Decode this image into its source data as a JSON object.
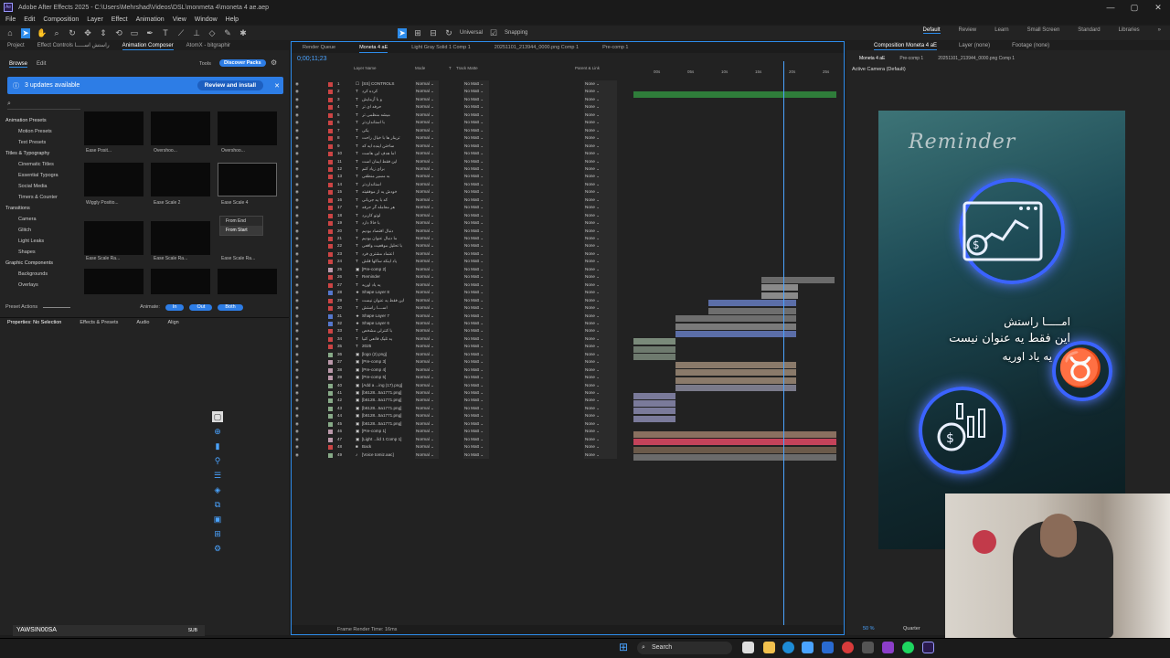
{
  "app": {
    "title": "Adobe After Effects 2025 - C:\\Users\\Mehrshad\\Videos\\DSL\\monmeta 4\\moneta 4 ae.aep",
    "window_controls": [
      "—",
      "▢",
      "✕"
    ]
  },
  "menu": [
    "File",
    "Edit",
    "Composition",
    "Layer",
    "Effect",
    "Animation",
    "View",
    "Window",
    "Help"
  ],
  "toolbar": {
    "universal_label": "Universal",
    "snapping_label": "Snapping"
  },
  "workspaces": [
    "Default",
    "Review",
    "Learn",
    "Small Screen",
    "Standard",
    "Libraries"
  ],
  "left_panel": {
    "tabs": [
      "Project",
      "Effect Controls راستش اســـــا",
      "Animation Composer",
      "AtomX - bitgraphir"
    ],
    "subtabs": [
      "Browse",
      "Edit"
    ],
    "tools_label": "Tools",
    "discover_label": "Discover Packs",
    "banner_text": "3 updates available",
    "banner_button": "Review and install",
    "tree": [
      {
        "label": "Animation Presets",
        "level": 0
      },
      {
        "label": "Motion Presets",
        "level": 1
      },
      {
        "label": "Text Presets",
        "level": 1
      },
      {
        "label": "Titles & Typography",
        "level": 0
      },
      {
        "label": "Cinematic Titles",
        "level": 1
      },
      {
        "label": "Essential Typogra",
        "level": 1
      },
      {
        "label": "Social Media",
        "level": 1
      },
      {
        "label": "Timers & Counter",
        "level": 1
      },
      {
        "label": "Transitions",
        "level": 0
      },
      {
        "label": "Camera",
        "level": 1
      },
      {
        "label": "Glitch",
        "level": 1
      },
      {
        "label": "Light Leaks",
        "level": 1
      },
      {
        "label": "Shapes",
        "level": 1
      },
      {
        "label": "Graphic Components",
        "level": 0
      },
      {
        "label": "Backgrounds",
        "level": 1
      },
      {
        "label": "Overlays",
        "level": 1
      }
    ],
    "thumbs": [
      "Ease Posit...",
      "Overshoo...",
      "Overshoo...",
      "Wiggly Positio...",
      "Ease Scale 2",
      "Ease Scale 4",
      "Ease Scale Ra...",
      "Ease Scale Ra...",
      "Ease Scale Ra..."
    ],
    "dropdown": [
      "From End",
      "From Start"
    ],
    "preset_actions": "Preset Actions",
    "animate_label": "Animate:",
    "animate_buttons": [
      "In",
      "Out",
      "Both"
    ],
    "bottom_tabs": [
      "Properties: No Selection",
      "Effects & Presets",
      "Audio",
      "Align"
    ],
    "user_label": "YAWSIN00SA",
    "user_tag": "SUB"
  },
  "timeline": {
    "tabs": [
      "Render Queue",
      "Moneta 4 aE",
      "Light Gray Solid 1 Comp 1",
      "20251101_213944_0000.png Comp 1",
      "Pre-comp 1"
    ],
    "timecode": "0;00;11;23",
    "columns": [
      "Layer Name",
      "Mode",
      "T",
      "Track Matte",
      "Parent & Link"
    ],
    "footer": "Frame Render Time: 16ms",
    "layers": [
      {
        "n": "1",
        "ic": "☐",
        "name": "[SS] CONTROLS",
        "c": "#c44"
      },
      {
        "n": "2",
        "ic": "T",
        "name": "کرده کرد",
        "c": "#c44"
      },
      {
        "n": "3",
        "ic": "T",
        "name": "و با آزمایش",
        "c": "#c44"
      },
      {
        "n": "4",
        "ic": "T",
        "name": "حرفه ای تر",
        "c": "#c44"
      },
      {
        "n": "5",
        "ic": "T",
        "name": "میشه منظمی تر",
        "c": "#c44"
      },
      {
        "n": "6",
        "ic": "T",
        "name": "با استانداردتر",
        "c": "#c44"
      },
      {
        "n": "7",
        "ic": "T",
        "name": "یکی",
        "c": "#c44"
      },
      {
        "n": "8",
        "ic": "T",
        "name": "ترینار ها با خیال راحت",
        "c": "#c44"
      },
      {
        "n": "9",
        "ic": "T",
        "name": "ساختن اینده ایه که",
        "c": "#c44"
      },
      {
        "n": "10",
        "ic": "T",
        "name": "اما هدف این هاست",
        "c": "#c44"
      },
      {
        "n": "11",
        "ic": "T",
        "name": "این فقط ایمان است",
        "c": "#c44"
      },
      {
        "n": "12",
        "ic": "T",
        "name": "برای زیاد کنم",
        "c": "#c44"
      },
      {
        "n": "13",
        "ic": "T",
        "name": "به مسیر منطقی",
        "c": "#c44"
      },
      {
        "n": "14",
        "ic": "T",
        "name": "استانداردتر",
        "c": "#c44"
      },
      {
        "n": "15",
        "ic": "T",
        "name": "خودش یه از موفقیته",
        "c": "#c44"
      },
      {
        "n": "16",
        "ic": "T",
        "name": "که با یه جریانی",
        "c": "#c44"
      },
      {
        "n": "17",
        "ic": "T",
        "name": "هر معامله گر حرفه",
        "c": "#c44"
      },
      {
        "n": "18",
        "ic": "T",
        "name": "لوتو کاربرد",
        "c": "#c44"
      },
      {
        "n": "19",
        "ic": "T",
        "name": "با خالا دارد",
        "c": "#c44"
      },
      {
        "n": "20",
        "ic": "T",
        "name": "دنبال اقتصاد بودیم",
        "c": "#c44"
      },
      {
        "n": "21",
        "ic": "T",
        "name": "ما دنبال عنوان بودیم",
        "c": "#c44"
      },
      {
        "n": "22",
        "ic": "T",
        "name": "با تحلیل موقعیت واقعی",
        "c": "#c44"
      },
      {
        "n": "23",
        "ic": "T",
        "name": "اعتماد مشتری فرد",
        "c": "#c44"
      },
      {
        "n": "24",
        "ic": "T",
        "name": "یاد اینکه ساکها قلش",
        "c": "#c44"
      },
      {
        "n": "25",
        "ic": "▣",
        "name": "[Pre-comp 2]",
        "c": "#b9a"
      },
      {
        "n": "26",
        "ic": "T",
        "name": "Reminder",
        "c": "#c44"
      },
      {
        "n": "27",
        "ic": "T",
        "name": "یه یاد اوریه",
        "c": "#c44"
      },
      {
        "n": "28",
        "ic": "★",
        "name": "Shape Layer 8",
        "c": "#57c"
      },
      {
        "n": "29",
        "ic": "T",
        "name": "این فقط یه عنوان نیست",
        "c": "#c44"
      },
      {
        "n": "30",
        "ic": "T",
        "name": "اســــا راستش",
        "c": "#c44"
      },
      {
        "n": "31",
        "ic": "★",
        "name": "Shape Layer 7",
        "c": "#57c"
      },
      {
        "n": "32",
        "ic": "★",
        "name": "Shape Layer 6",
        "c": "#57c"
      },
      {
        "n": "33",
        "ic": "T",
        "name": "با کنترلی مشخص",
        "c": "#c44"
      },
      {
        "n": "34",
        "ic": "T",
        "name": "یه تلیک قانعی کنیا",
        "c": "#c44"
      },
      {
        "n": "35",
        "ic": "T",
        "name": "2025",
        "c": "#c44"
      },
      {
        "n": "36",
        "ic": "▣",
        "name": "[logo (2).png]",
        "c": "#8a8"
      },
      {
        "n": "37",
        "ic": "▣",
        "name": "[Pre-comp 3]",
        "c": "#b9a"
      },
      {
        "n": "38",
        "ic": "▣",
        "name": "[Pre-comp 4]",
        "c": "#b9a"
      },
      {
        "n": "39",
        "ic": "▣",
        "name": "[Pre-comp 5]",
        "c": "#b9a"
      },
      {
        "n": "40",
        "ic": "▣",
        "name": "[Add a ...ing (17).png]",
        "c": "#8a8"
      },
      {
        "n": "41",
        "ic": "▣",
        "name": "[b6128...5a1771.png]",
        "c": "#8a8"
      },
      {
        "n": "42",
        "ic": "▣",
        "name": "[b6128...5a1771.png]",
        "c": "#8a8"
      },
      {
        "n": "43",
        "ic": "▣",
        "name": "[b6128...5a1771.png]",
        "c": "#8a8"
      },
      {
        "n": "44",
        "ic": "▣",
        "name": "[b6128...5a1771.png]",
        "c": "#8a8"
      },
      {
        "n": "45",
        "ic": "▣",
        "name": "[b6128...5a1771.png]",
        "c": "#8a8"
      },
      {
        "n": "46",
        "ic": "▣",
        "name": "[Pre-comp 1]",
        "c": "#b9a"
      },
      {
        "n": "47",
        "ic": "▣",
        "name": "[Light ...lid 1 Comp 1]",
        "c": "#b9a"
      },
      {
        "n": "48",
        "ic": "■",
        "name": "Back",
        "c": "#c44"
      },
      {
        "n": "49",
        "ic": "♪",
        "name": "[Voice tomiz.aac]",
        "c": "#8a8"
      }
    ],
    "mode_value": "Normal",
    "matte_value": "No Matt",
    "parent_value": "None",
    "ruler": [
      "00s",
      "05s",
      "10s",
      "15s",
      "20s",
      "25s"
    ]
  },
  "composition": {
    "tabs": [
      "Composition Moneta 4 aE",
      "Layer (none)",
      "Footage (none)"
    ],
    "subtabs": [
      "Moneta 4 aE",
      "Pre-comp 1",
      "20251101_213944_0000.png Comp 1"
    ],
    "camera_label": "Active Camera (Default)",
    "reminder": "Reminder",
    "fa_line1": "امـــــا راستش",
    "fa_line2": "این فقط یه عنوان نیست",
    "fa_line3": "یه یاد اوریه",
    "zoom": "50 %",
    "quality": "Quarter"
  },
  "taskbar": {
    "search": "Search"
  }
}
